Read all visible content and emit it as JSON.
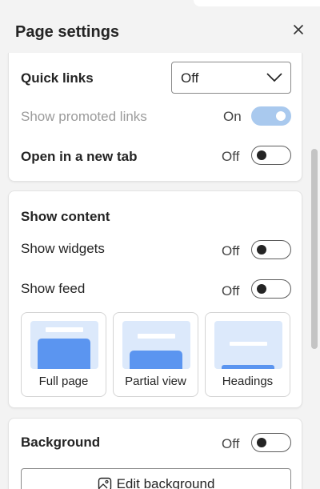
{
  "header": {
    "title": "Page settings"
  },
  "quick_links": {
    "label": "Quick links",
    "dropdown_value": "Off",
    "show_promoted": {
      "label": "Show promoted links",
      "state": "On",
      "enabled": true,
      "disabled": true
    },
    "open_new_tab": {
      "label": "Open in a new tab",
      "state": "Off",
      "enabled": false
    }
  },
  "show_content": {
    "heading": "Show content",
    "widgets": {
      "label": "Show widgets",
      "state": "Off",
      "enabled": false
    },
    "feed": {
      "label": "Show feed",
      "state": "Off",
      "enabled": false
    },
    "layouts": [
      {
        "label": "Full page"
      },
      {
        "label": "Partial view"
      },
      {
        "label": "Headings"
      }
    ]
  },
  "background": {
    "label": "Background",
    "state": "Off",
    "enabled": false,
    "edit_button": "Edit background"
  },
  "colors": {
    "accent_toggle_on": "#a9c9ee",
    "preview_bg": "#dce9fb",
    "preview_block": "#5b95f0"
  },
  "icons": [
    "close-icon",
    "chevron-down-icon",
    "image-icon"
  ]
}
